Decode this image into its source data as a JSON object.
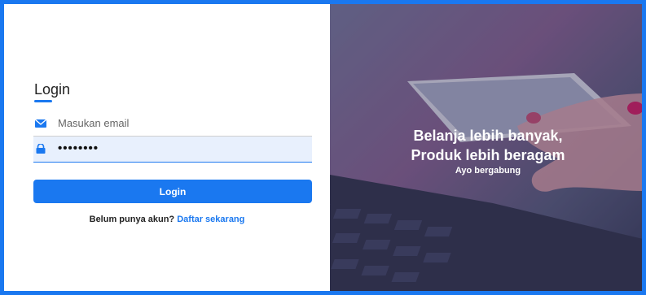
{
  "login": {
    "title": "Login",
    "email_placeholder": "Masukan email",
    "password_value": "••••••••",
    "button_label": "Login",
    "signup_prompt": "Belum punya akun?",
    "signup_link": "Daftar sekarang"
  },
  "hero": {
    "headline_line1": "Belanja lebih banyak,",
    "headline_line2": "Produk lebih beragam",
    "tagline": "Ayo bergabung"
  },
  "colors": {
    "accent": "#1a78f0",
    "password_field_bg": "#e8f0fd"
  },
  "icons": {
    "email": "envelope-icon",
    "password": "lock-icon"
  }
}
